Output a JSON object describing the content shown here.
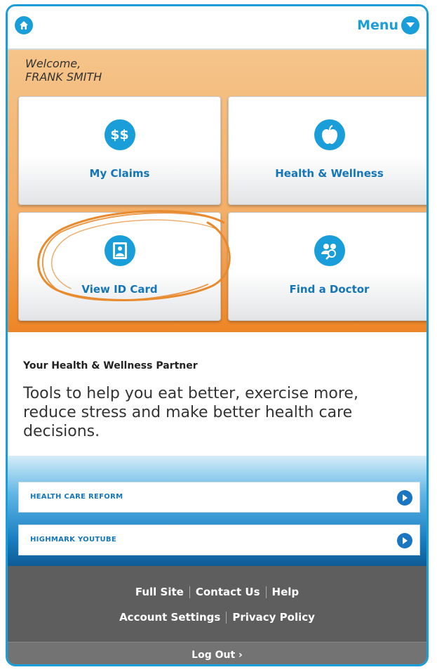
{
  "header": {
    "menu_label": "Menu",
    "home_icon": "home-icon",
    "menu_icon": "chevron-down-icon"
  },
  "welcome": {
    "line1": "Welcome,",
    "line2": "FRANK SMITH"
  },
  "tiles": [
    {
      "label": "My Claims",
      "icon": "dollar-icon",
      "icon_text": "$$"
    },
    {
      "label": "Health & Wellness",
      "icon": "apple-icon"
    },
    {
      "label": "View ID Card",
      "icon": "id-card-icon"
    },
    {
      "label": "Find a Doctor",
      "icon": "doctor-search-icon"
    }
  ],
  "partner": {
    "title": "Your Health & Wellness Partner",
    "text": "Tools to help you eat better, exercise more, reduce stress and make better health care decisions."
  },
  "links": [
    {
      "label": "HEALTH CARE REFORM"
    },
    {
      "label": "HIGHMARK YOUTUBE"
    }
  ],
  "footer": {
    "full_site": "Full Site",
    "contact_us": "Contact Us",
    "help": "Help",
    "account_settings": "Account Settings",
    "privacy_policy": "Privacy Policy",
    "log_out": "Log Out ›"
  },
  "colors": {
    "accent": "#1a9ed9",
    "orange": "#ed8526",
    "footer": "#5e5e5e",
    "annotation": "#e88a2e"
  }
}
